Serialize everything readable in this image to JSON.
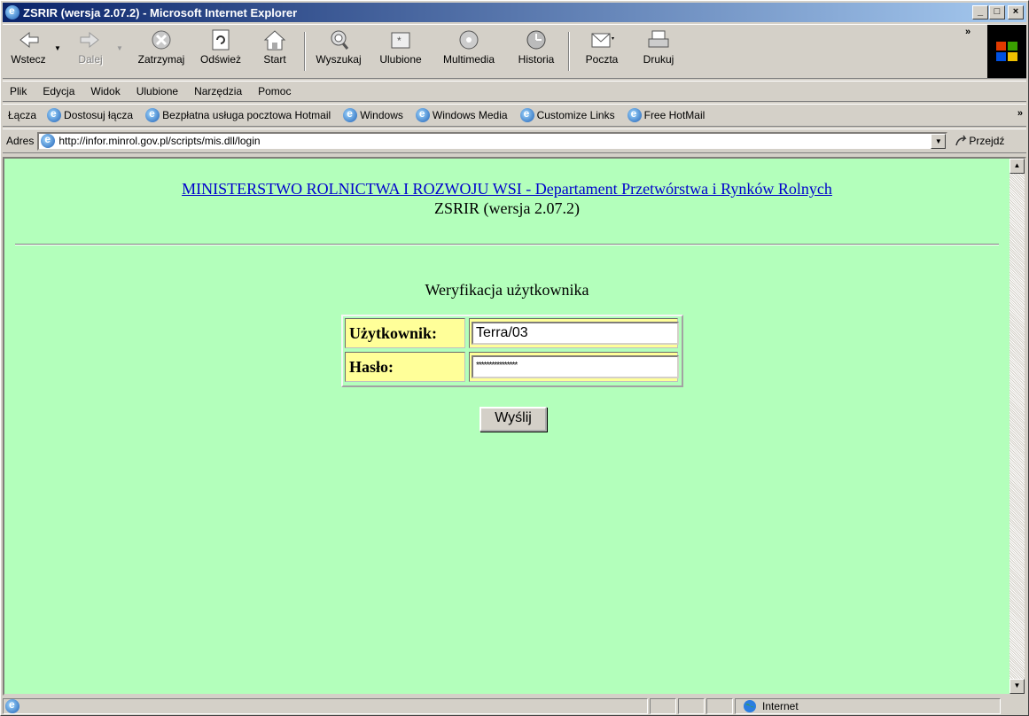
{
  "window": {
    "title": "ZSRIR (wersja 2.07.2) - Microsoft Internet Explorer",
    "minimize": "_",
    "maximize": "□",
    "close": "×"
  },
  "toolbar": {
    "back": "Wstecz",
    "forward": "Dalej",
    "stop": "Zatrzymaj",
    "refresh": "Odśwież",
    "home": "Start",
    "search": "Wyszukaj",
    "favorites": "Ulubione",
    "media": "Multimedia",
    "history": "Historia",
    "mail": "Poczta",
    "print": "Drukuj",
    "more": "»"
  },
  "menu": [
    "Plik",
    "Edycja",
    "Widok",
    "Ulubione",
    "Narzędzia",
    "Pomoc"
  ],
  "links": {
    "label": "Łącza",
    "items": [
      "Dostosuj łącza",
      "Bezpłatna usługa pocztowa Hotmail",
      "Windows",
      "Windows Media",
      "Customize Links",
      "Free HotMail"
    ],
    "more": "»"
  },
  "address": {
    "label": "Adres",
    "url": "http://infor.minrol.gov.pl/scripts/mis.dll/login",
    "go": "Przejdź"
  },
  "page": {
    "ministry_link": "MINISTERSTWO ROLNICTWA I ROZWOJU WSI - Departament Przetwórstwa i Rynków Rolnych",
    "version": "ZSRIR (wersja 2.07.2)",
    "heading": "Weryfikacja użytkownika",
    "user_label": "Użytkownik:",
    "user_value": "Terra/03",
    "password_label": "Hasło:",
    "password_value": "****************",
    "submit": "Wyślij",
    "background": "#b3ffbb"
  },
  "status": {
    "zone": "Internet"
  }
}
